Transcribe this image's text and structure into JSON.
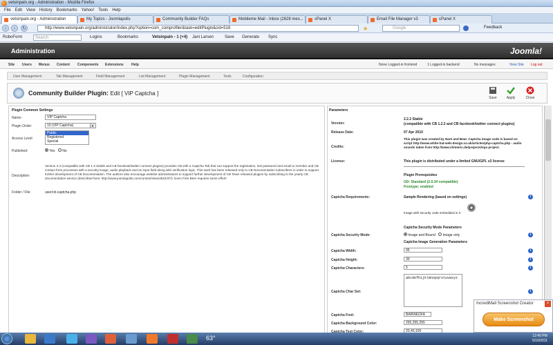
{
  "browser": {
    "window_title": "vetsinpain.org - Administration - Mozilla Firefox",
    "menu": [
      "File",
      "Edit",
      "View",
      "History",
      "Bookmarks",
      "Yahoo!",
      "Tools",
      "Help"
    ],
    "tabs": [
      {
        "label": "vetsinpain.org - Administration",
        "active": true
      },
      {
        "label": "My Topics - Joomlapolis",
        "active": false
      },
      {
        "label": "Community Builder FAQs",
        "active": false
      },
      {
        "label": "Mobileme Mail - Inbox (2628 mes...",
        "active": false
      },
      {
        "label": "cPanel X",
        "active": false
      },
      {
        "label": "Email File Manager v3",
        "active": false
      },
      {
        "label": "cPanel X",
        "active": false
      }
    ],
    "url": "http://www.vetsinpain.org/administrator/index.php?option=com_comprofiler&task=editPlugin&cid=516",
    "search_placeholder": "Google",
    "feedback_label": "Feedback",
    "bookmarks": {
      "roboform": "RoboForm",
      "search": "Search",
      "logins": "Logins",
      "bookmarks": "Bookmarks",
      "vetsinpain": "Vetsinpain - 1 (+4)",
      "user": "Jani Larsen",
      "save": "Save",
      "generate": "Generate",
      "sync": "Sync"
    }
  },
  "joomla": {
    "header_title": "Administration",
    "logo": "Joomla!",
    "menu": [
      "Site",
      "Users",
      "Menus",
      "Content",
      "Components",
      "Extensions",
      "Help"
    ],
    "status": {
      "frontend": "None Logged-in frontend",
      "backend": "1 Logged-in backend",
      "messages": "No messages",
      "view_site": "View Site",
      "logout": "Log out"
    },
    "submenu": [
      "User Management",
      "Tab Management",
      "Field Management",
      "List Management",
      "Plugin Management",
      "Tools",
      "Configuration"
    ],
    "page_title_main": "Community Builder Plugin:",
    "page_title_sub": "Edit [ VIP Captcha ]",
    "toolbar": {
      "save": "Save",
      "apply": "Apply",
      "close": "Close"
    }
  },
  "plugin": {
    "section_title": "Plugin Common Settings",
    "name_label": "Name:",
    "name_value": "VIP Captcha",
    "order_label": "Plugin Order:",
    "order_value": "10 (VIP Captcha)",
    "access_label": "Access Level:",
    "access_options": [
      "Public",
      "Registered",
      "Special"
    ],
    "access_selected": "Public",
    "published_label": "Published:",
    "published_yes": "Yes",
    "published_no": "No",
    "description_label": "Description:",
    "description": "Version 2.3 (compatible with CB 1.3 Stable and CB facebook/twitter connect plugins) provides CB with a Captcha Tab that can support the registration, lost password and email to member and CB contact form processes with a security image, audio playback and an input field along with verification logic. This work has been released only to CB Documentation subscribers in order to support further development of CB Documentation. The authors also encourage website administrators to support further development of CB Team released plugins by subscribing to the yearly CB documentation service (described here: http://www.joomlapolis.com/content/view/2542/37/). Even Free Beer requires some effort!",
    "folder_label": "Folder / File:",
    "folder_value": "user/cb.captcha.php"
  },
  "parameters": {
    "section_title": "Parameters",
    "version_label": "Version:",
    "version_value": "2.2.2 Stable",
    "version_note": "(compatible with CB 1.2.2 and CB facebook/twitter connect plugins)",
    "release_label": "Release Date:",
    "release_value": "07 Apr 2010",
    "credits_label": "Credits:",
    "credits_value": "This plugin was created by Nant and Beat. Captcha image code is based on script http://www.white-hat-web-design.co.uk/articles/php-captcha.php - audio sounds taken from http://www.chimeric.de/projects/npa project.",
    "license_label": "License:",
    "license_value": "This plugin is distributed under a limited GNU/GPL v2 license",
    "prereq_title": "Plugin Prerequisites",
    "gd_value": "GD: Standard (2.0.34 compatible)",
    "freetype_value": "Freetype: enabled",
    "requirements_label": "Captcha Requirements:",
    "sample_title": "Sample Rendering (based on settings)",
    "sample_caption": "Image with security code embedded in it",
    "security_mode_title": "Captcha Security Mode Parameters",
    "security_mode_label": "Captcha Security Mode:",
    "mode_bound": "Image and Bound",
    "mode_only": "Image only",
    "image_gen_title": "Captcha Image Generation Parameters",
    "width_label": "Captcha Width:",
    "width_value": "95",
    "height_label": "Captcha Height:",
    "height_value": "30",
    "chars_label": "Captcha Characters:",
    "chars_value": "5",
    "charset_label": "Captcha Char Set:",
    "charset_value": "abcdefhijklmnopqrstuvwxyz",
    "font_label": "Captcha Font:",
    "font_value": "BARWEDFA",
    "bg_label": "Captcha Background Color:",
    "bg_value": "255,255,255",
    "text_label": "Captcha Text Color:",
    "text_value": "20,40,100"
  },
  "popup": {
    "title": "IncrediMail Screenshot Creator",
    "button": "Make Screenshot"
  },
  "taskbar": {
    "temperature": "63°",
    "time": "12:40 PM",
    "date": "5/16/2011"
  }
}
